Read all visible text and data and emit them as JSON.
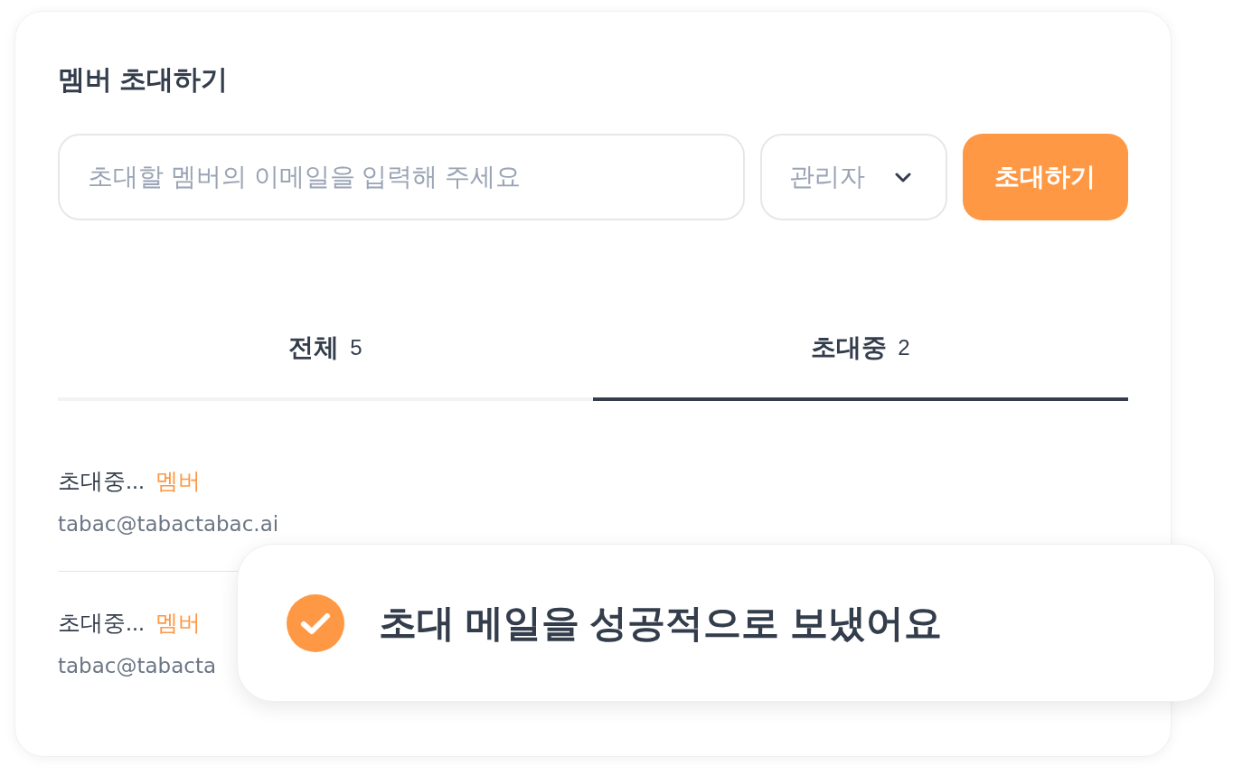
{
  "title": "멤버 초대하기",
  "invite_form": {
    "email": {
      "placeholder": "초대할 멤버의 이메일을 입력해 주세요"
    },
    "role_dropdown": {
      "value": "관리자"
    },
    "submit_button": "초대하기"
  },
  "tabs": [
    {
      "label": "전체",
      "count": "5",
      "selected": false
    },
    {
      "label": "초대중",
      "count": "2",
      "selected": true
    }
  ],
  "members": [
    {
      "name": "초대중...",
      "role": "멤버",
      "email": "tabac@tabactabac.ai"
    },
    {
      "name": "초대중...",
      "role": "멤버",
      "email": "tabac@tabacta"
    }
  ],
  "toast": {
    "message": "초대 메일을 성공적으로 보냈어요"
  }
}
